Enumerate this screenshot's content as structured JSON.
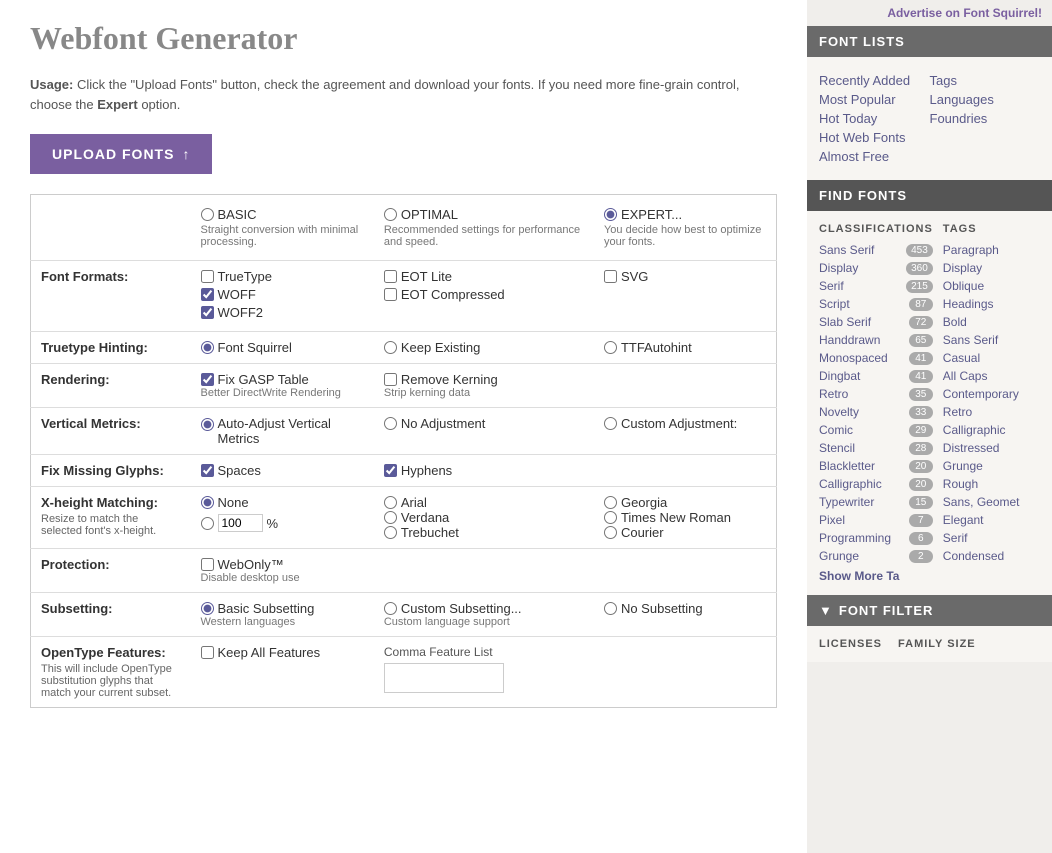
{
  "page": {
    "title": "Webfont Generator",
    "advertise": "Advertise on Font Squirrel!",
    "usage_bold": "Usage:",
    "usage_text": " Click the \"Upload Fonts\" button, check the agreement and download your fonts. If you need more fine-grain control, choose the ",
    "usage_expert": "Expert",
    "usage_end": " option.",
    "upload_btn": "UPLOAD FONTS"
  },
  "modes": [
    {
      "id": "basic",
      "label": "BASIC",
      "desc": "Straight conversion with minimal processing."
    },
    {
      "id": "optimal",
      "label": "OPTIMAL",
      "desc": "Recommended settings for performance and speed."
    },
    {
      "id": "expert",
      "label": "EXPERT...",
      "desc": "You decide how best to optimize your fonts.",
      "selected": true
    }
  ],
  "rows": [
    {
      "label": "Font Formats:",
      "sub": "",
      "cols": [
        {
          "items": [
            {
              "type": "checkbox",
              "label": "TrueType",
              "checked": false
            },
            {
              "type": "checkbox",
              "label": "WOFF",
              "checked": true
            },
            {
              "type": "checkbox",
              "label": "WOFF2",
              "checked": true
            }
          ]
        },
        {
          "items": [
            {
              "type": "checkbox",
              "label": "EOT Lite",
              "checked": false
            },
            {
              "type": "checkbox",
              "label": "EOT Compressed",
              "checked": false
            }
          ]
        },
        {
          "items": [
            {
              "type": "checkbox",
              "label": "SVG",
              "checked": false
            }
          ]
        }
      ]
    },
    {
      "label": "Truetype Hinting:",
      "sub": "",
      "cols": [
        {
          "items": [
            {
              "type": "radio",
              "label": "Font Squirrel",
              "checked": true,
              "name": "hinting"
            }
          ]
        },
        {
          "items": [
            {
              "type": "radio",
              "label": "Keep Existing",
              "checked": false,
              "name": "hinting"
            }
          ]
        },
        {
          "items": [
            {
              "type": "radio",
              "label": "TTFAutohint",
              "checked": false,
              "name": "hinting"
            }
          ]
        }
      ]
    },
    {
      "label": "Rendering:",
      "sub": "",
      "cols": [
        {
          "items": [
            {
              "type": "checkbox",
              "label": "Fix GASP Table",
              "checked": true
            },
            {
              "type": "label",
              "text": "Better DirectWrite Rendering"
            }
          ]
        },
        {
          "items": [
            {
              "type": "checkbox",
              "label": "Remove Kerning",
              "checked": false
            },
            {
              "type": "label",
              "text": "Strip kerning data"
            }
          ]
        },
        {
          "items": []
        }
      ]
    },
    {
      "label": "Vertical Metrics:",
      "sub": "",
      "cols": [
        {
          "items": [
            {
              "type": "radio",
              "label": "Auto-Adjust Vertical Metrics",
              "checked": true,
              "name": "vmetrics"
            }
          ]
        },
        {
          "items": [
            {
              "type": "radio",
              "label": "No Adjustment",
              "checked": false,
              "name": "vmetrics"
            }
          ]
        },
        {
          "items": [
            {
              "type": "radio",
              "label": "Custom Adjustment:",
              "checked": false,
              "name": "vmetrics"
            }
          ]
        }
      ]
    },
    {
      "label": "Fix Missing Glyphs:",
      "sub": "",
      "cols": [
        {
          "items": [
            {
              "type": "checkbox",
              "label": "Spaces",
              "checked": true
            }
          ]
        },
        {
          "items": [
            {
              "type": "checkbox",
              "label": "Hyphens",
              "checked": true
            }
          ]
        },
        {
          "items": []
        }
      ]
    },
    {
      "label": "X-height Matching:",
      "sub": "Resize to match the selected font's x-height.",
      "cols": [
        {
          "items": [
            {
              "type": "radio",
              "label": "None",
              "checked": true,
              "name": "xheight"
            },
            {
              "type": "number_input",
              "value": "100",
              "unit": "%"
            }
          ]
        },
        {
          "items": [
            {
              "type": "radio",
              "label": "Arial",
              "checked": false,
              "name": "xheight"
            },
            {
              "type": "radio",
              "label": "Verdana",
              "checked": false,
              "name": "xheight"
            },
            {
              "type": "radio",
              "label": "Trebuchet",
              "checked": false,
              "name": "xheight"
            }
          ]
        },
        {
          "items": [
            {
              "type": "radio",
              "label": "Georgia",
              "checked": false,
              "name": "xheight"
            },
            {
              "type": "radio",
              "label": "Times New Roman",
              "checked": false,
              "name": "xheight"
            },
            {
              "type": "radio",
              "label": "Courier",
              "checked": false,
              "name": "xheight"
            }
          ]
        }
      ]
    },
    {
      "label": "Protection:",
      "sub": "",
      "cols": [
        {
          "items": [
            {
              "type": "checkbox",
              "label": "WebOnly™",
              "checked": false
            },
            {
              "type": "label",
              "text": "Disable desktop use"
            }
          ]
        },
        {
          "items": []
        },
        {
          "items": []
        }
      ]
    },
    {
      "label": "Subsetting:",
      "sub": "",
      "cols": [
        {
          "items": [
            {
              "type": "radio",
              "label": "Basic Subsetting",
              "checked": true,
              "name": "subsetting"
            },
            {
              "type": "label",
              "text": "Western languages"
            }
          ]
        },
        {
          "items": [
            {
              "type": "radio",
              "label": "Custom Subsetting...",
              "checked": false,
              "name": "subsetting"
            },
            {
              "type": "label",
              "text": "Custom language support"
            }
          ]
        },
        {
          "items": [
            {
              "type": "radio",
              "label": "No Subsetting",
              "checked": false,
              "name": "subsetting"
            }
          ]
        }
      ]
    },
    {
      "label": "OpenType Features:",
      "sub": "This will include OpenType substitution glyphs that match your current subset.",
      "cols": [
        {
          "items": [
            {
              "type": "checkbox",
              "label": "Keep All Features",
              "checked": false
            }
          ]
        },
        {
          "items": [
            {
              "type": "label_header",
              "text": "Comma Feature List"
            }
          ]
        },
        {
          "items": []
        }
      ]
    }
  ],
  "sidebar": {
    "advertise": "Advertise on Font Squirrel!",
    "font_lists_header": "FONT LISTS",
    "font_lists_col1": [
      "Recently Added",
      "Most Popular",
      "Hot Today",
      "Hot Web Fonts",
      "Almost Free"
    ],
    "font_lists_col2": [
      "Tags",
      "Languages",
      "Foundries"
    ],
    "find_fonts_header": "FIND FONTS",
    "classifications_header": "CLASSIFICATIONS",
    "tags_header": "TAGS",
    "classifications": [
      {
        "label": "Sans Serif",
        "count": "453"
      },
      {
        "label": "Display",
        "count": "360"
      },
      {
        "label": "Serif",
        "count": "215"
      },
      {
        "label": "Script",
        "count": "87"
      },
      {
        "label": "Slab Serif",
        "count": "72"
      },
      {
        "label": "Handdrawn",
        "count": "65"
      },
      {
        "label": "Monospaced",
        "count": "41"
      },
      {
        "label": "Dingbat",
        "count": "41"
      },
      {
        "label": "Retro",
        "count": "35"
      },
      {
        "label": "Novelty",
        "count": "33"
      },
      {
        "label": "Comic",
        "count": "29"
      },
      {
        "label": "Stencil",
        "count": "28"
      },
      {
        "label": "Blackletter",
        "count": "20"
      },
      {
        "label": "Calligraphic",
        "count": "20"
      },
      {
        "label": "Typewriter",
        "count": "15"
      },
      {
        "label": "Pixel",
        "count": "7"
      },
      {
        "label": "Programming",
        "count": "6"
      },
      {
        "label": "Grunge",
        "count": "2"
      }
    ],
    "tags": [
      {
        "label": "Paragraph"
      },
      {
        "label": "Display"
      },
      {
        "label": "Oblique"
      },
      {
        "label": "Headings"
      },
      {
        "label": "Bold"
      },
      {
        "label": "Sans Serif"
      },
      {
        "label": "Casual"
      },
      {
        "label": "All Caps"
      },
      {
        "label": "Contemporary"
      },
      {
        "label": "Retro"
      },
      {
        "label": "Calligraphic"
      },
      {
        "label": "Distressed"
      },
      {
        "label": "Grunge"
      },
      {
        "label": "Rough"
      },
      {
        "label": "Sans, Geomet"
      },
      {
        "label": "Elegant"
      },
      {
        "label": "Serif"
      },
      {
        "label": "Condensed"
      }
    ],
    "show_more": "Show More Ta",
    "font_filter_header": "FONT FILTER",
    "licenses_label": "LICENSES",
    "family_size_label": "FAMILY SIZE"
  }
}
